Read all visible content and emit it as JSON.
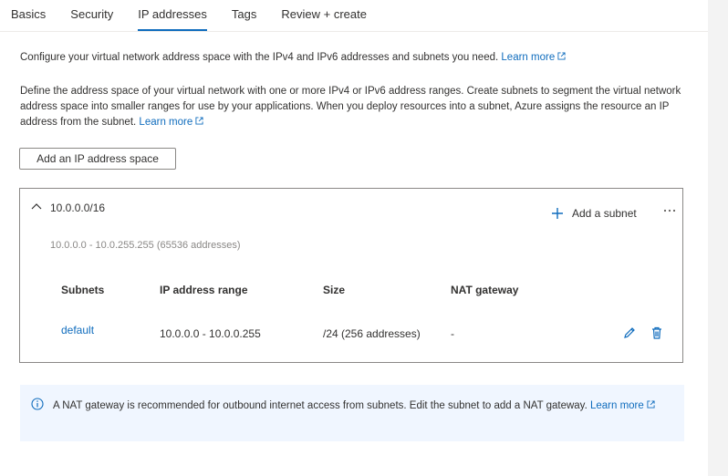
{
  "tabs": [
    {
      "label": "Basics"
    },
    {
      "label": "Security"
    },
    {
      "label": "IP addresses"
    },
    {
      "label": "Tags"
    },
    {
      "label": "Review + create"
    }
  ],
  "intro": {
    "text": "Configure your virtual network address space with the IPv4 and IPv6 addresses and subnets you need.",
    "link": "Learn more"
  },
  "description": {
    "text": "Define the address space of your virtual network with one or more IPv4 or IPv6 address ranges. Create subnets to segment the virtual network address space into smaller ranges for use by your applications. When you deploy resources into a subnet, Azure assigns the resource an IP address from the subnet.",
    "link": "Learn more"
  },
  "add_space_button": "Add an IP address space",
  "address_space": {
    "prefix": "10.0.0.0/16",
    "range": "10.0.0.0 - 10.0.255.255 (65536 addresses)",
    "add_subnet": "Add a subnet",
    "columns": [
      "Subnets",
      "IP address range",
      "Size",
      "NAT gateway"
    ],
    "rows": [
      {
        "name": "default",
        "range": "10.0.0.0 - 10.0.0.255",
        "size": "/24 (256 addresses)",
        "nat": "-"
      }
    ]
  },
  "info": {
    "text": "A NAT gateway is recommended for outbound internet access from subnets. Edit the subnet to add a NAT gateway.",
    "link": "Learn more"
  },
  "colors": {
    "accent": "#0f6cbd",
    "info_bg": "#f0f6ff",
    "border": "#8a8886"
  }
}
